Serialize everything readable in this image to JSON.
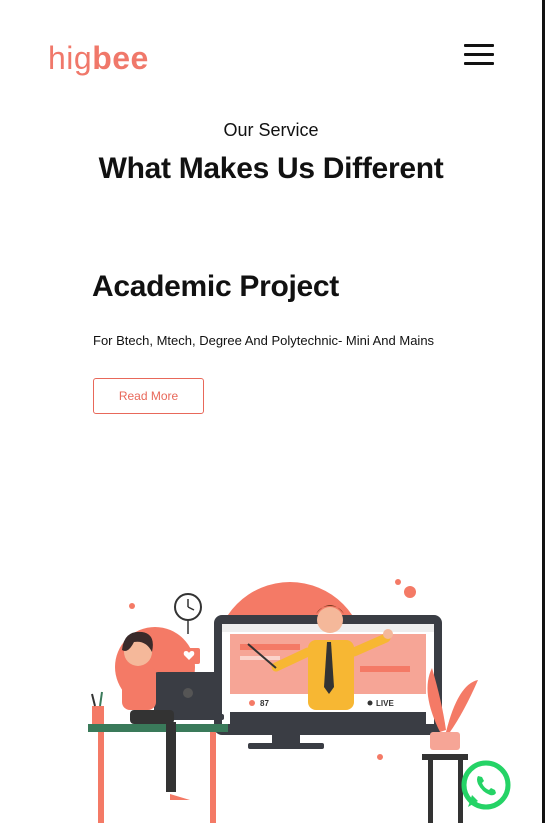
{
  "header": {
    "logo_part1": "hig",
    "logo_part2": "bee"
  },
  "section": {
    "eyebrow": "Our Service",
    "heading": "What Makes Us Different"
  },
  "service": {
    "title": "Academic Project",
    "description": "For Btech, Mtech, Degree And Polytechnic- Mini And Mains",
    "button_label": "Read More"
  },
  "illustration": {
    "viewer_count": "87",
    "live_label": "LIVE"
  },
  "colors": {
    "brand": "#f0786a",
    "accent": "#e8685a",
    "whatsapp": "#25d366"
  }
}
